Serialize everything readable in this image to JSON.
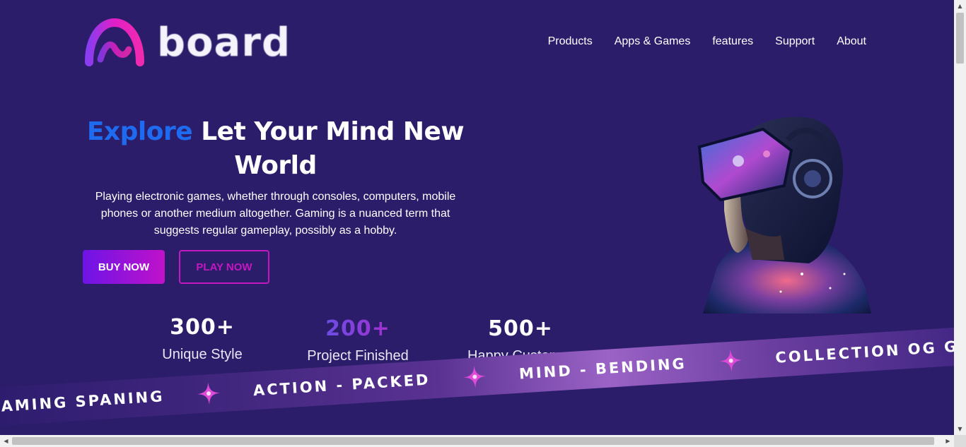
{
  "header": {
    "logo_text": "board",
    "nav": [
      "Products",
      "Apps & Games",
      "features",
      "Support",
      "About"
    ]
  },
  "hero": {
    "title_accent": "Explore",
    "title_rest": "Let Your Mind New World",
    "description": "Playing electronic games, whether through consoles, computers, mobile phones or another medium altogether. Gaming is a nuanced term that suggests regular gameplay, possibly as a hobby.",
    "buy_label": "BUY NOW",
    "play_label": "PLAY NOW"
  },
  "stats": [
    {
      "value": "300+",
      "label": "Unique Style"
    },
    {
      "value": "200+",
      "label": "Project Finished"
    },
    {
      "value": "500+",
      "label": "Happy Customer"
    }
  ],
  "ribbon": [
    "AMING SPANING",
    "ACTION - PACKED",
    "MIND - BENDING",
    "COLLECTION OG GA"
  ],
  "colors": {
    "background": "#2c1d6a",
    "accent_blue": "#1f6bf0",
    "button_gradient_start": "#6d14e6",
    "button_gradient_end": "#c012c9",
    "outline_button": "#c318c0"
  },
  "icons": {
    "logo": "board-arch-logo-icon",
    "ribbon_separator": "sparkle-star-icon",
    "scroll_up": "scroll-up-arrow-icon",
    "scroll_down": "scroll-down-arrow-icon",
    "scroll_left": "scroll-left-arrow-icon",
    "scroll_right": "scroll-right-arrow-icon"
  }
}
